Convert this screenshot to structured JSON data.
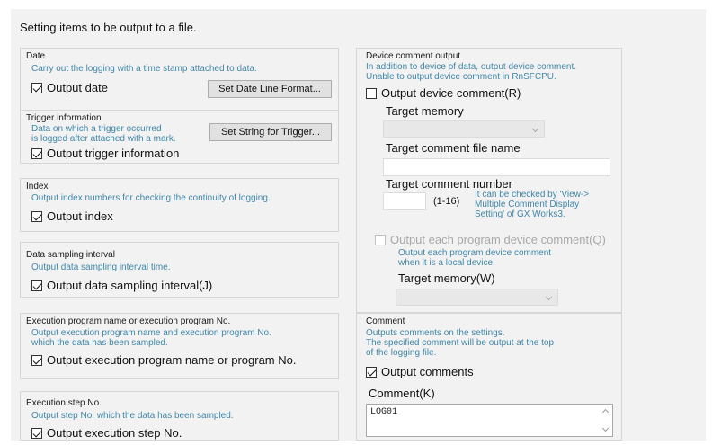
{
  "header": "Setting items to be output to a file.",
  "date": {
    "title": "Date",
    "desc": "Carry out the logging with a time stamp attached to data.",
    "checkbox": "Output date",
    "button": "Set Date Line Format..."
  },
  "trigger": {
    "title": "Trigger information",
    "desc": "Data on which a trigger occurred\nis logged after attached with a mark.",
    "checkbox": "Output trigger information",
    "button": "Set String for Trigger..."
  },
  "index": {
    "title": "Index",
    "desc": "Output index numbers for checking the continuity of logging.",
    "checkbox": "Output index"
  },
  "sampling": {
    "title": "Data sampling interval",
    "desc": "Output data sampling interval time.",
    "checkbox": "Output data sampling interval(J)"
  },
  "program": {
    "title": "Execution program name or execution program No.",
    "desc": "Output execution program name and execution program No.\nwhich the data has been sampled.",
    "checkbox": "Output execution program name or program No."
  },
  "step": {
    "title": "Execution step No.",
    "desc": "Output step No. which the data has been sampled.",
    "checkbox": "Output execution step No."
  },
  "device_comment": {
    "title": "Device comment output",
    "desc": "In addition to device of data, output device comment.\nUnable to output device comment in RnSFCPU.",
    "checkbox": "Output device comment(R)",
    "target_memory_label": "Target memory",
    "target_file_label": "Target comment file name",
    "target_number_label": "Target comment number",
    "range": "(1-16)",
    "range_note": "It can be checked by 'View->\nMultiple Comment Display\nSetting' of GX Works3.",
    "each_program_checkbox": "Output each program device comment(Q)",
    "each_program_desc": "Output each program device comment\nwhen it is a local device.",
    "target_memory_w_label": "Target memory(W)"
  },
  "comment": {
    "title": "Comment",
    "desc": "Outputs comments on the settings.\nThe specified comment will be output at the top\nof the logging file.",
    "checkbox": "Output comments",
    "field_label": "Comment(K)",
    "value": "LOG01"
  }
}
